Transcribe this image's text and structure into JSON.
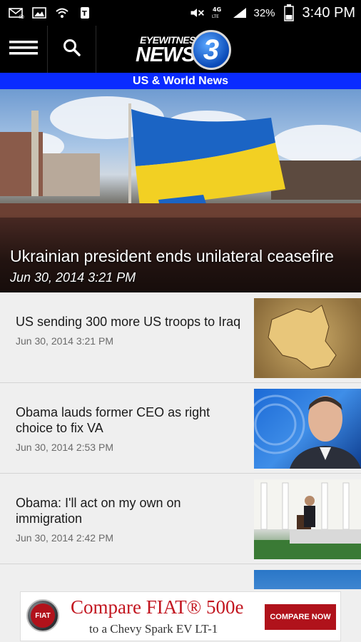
{
  "status_bar": {
    "icons": [
      "mail-icon",
      "image-icon",
      "wifi-icon",
      "tmobile-icon",
      "mute-icon",
      "4g-lte-icon",
      "signal-icon",
      "battery-icon"
    ],
    "network_label": "4G LTE",
    "battery_percent": "32%",
    "time": "3:40 PM"
  },
  "header": {
    "logo_line_1": "EYEWITNESS",
    "logo_line_2": "NEWS",
    "logo_number": "3",
    "menu_icon": "hamburger-menu-icon",
    "search_icon": "search-icon"
  },
  "section": {
    "title": "US & World News"
  },
  "hero": {
    "title": "Ukrainian president ends unilateral ceasefire",
    "date": "Jun 30, 2014 3:21 PM"
  },
  "articles": [
    {
      "title": "US sending 300 more US troops to Iraq",
      "date": "Jun 30, 2014 3:21 PM"
    },
    {
      "title": "Obama lauds former CEO as right choice to fix VA",
      "date": "Jun 30, 2014 2:53 PM"
    },
    {
      "title": "Obama: I'll act on my own on immigration",
      "date": "Jun 30, 2014 2:42 PM"
    }
  ],
  "ad": {
    "brand": "FIAT",
    "headline": "Compare FIAT® 500e",
    "subline": "to a Chevy Spark EV LT-1",
    "cta": "COMPARE NOW"
  },
  "colors": {
    "section_bar": "#0a2bff",
    "ad_red": "#b0121b",
    "header_bg": "#000000"
  }
}
